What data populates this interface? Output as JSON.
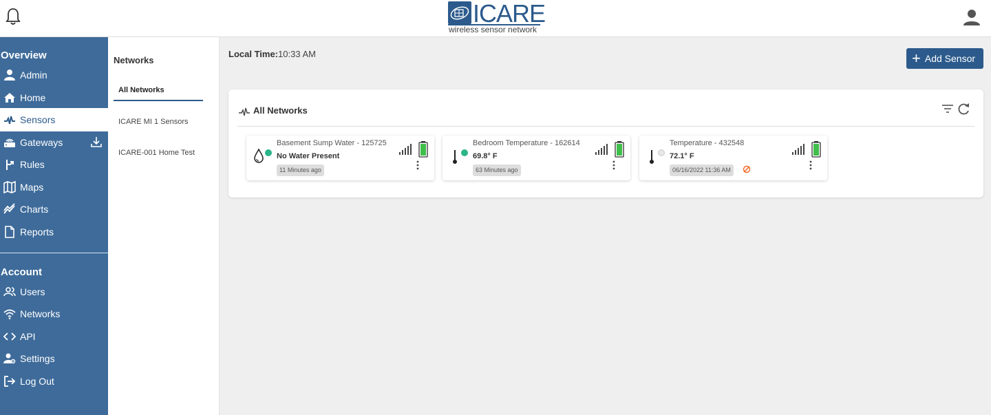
{
  "header": {
    "logo_text": "ICARE",
    "logo_subtitle": "wireless sensor network",
    "bell_icon": "bell-icon",
    "user_icon": "user-icon"
  },
  "sidebar": {
    "overview_title": "Overview",
    "account_title": "Account",
    "overview_items": [
      {
        "label": "Admin",
        "icon": "admin-icon"
      },
      {
        "label": "Home",
        "icon": "home-icon"
      },
      {
        "label": "Sensors",
        "icon": "pulse-icon",
        "active": true
      },
      {
        "label": "Gateways",
        "icon": "gateway-icon"
      },
      {
        "label": "Rules",
        "icon": "rules-icon"
      },
      {
        "label": "Maps",
        "icon": "map-icon"
      },
      {
        "label": "Charts",
        "icon": "chart-icon"
      },
      {
        "label": "Reports",
        "icon": "document-icon"
      }
    ],
    "account_items": [
      {
        "label": "Users",
        "icon": "users-icon"
      },
      {
        "label": "Networks",
        "icon": "wifi-icon"
      },
      {
        "label": "API",
        "icon": "code-icon"
      },
      {
        "label": "Settings",
        "icon": "user-settings-icon"
      },
      {
        "label": "Log Out",
        "icon": "logout-icon"
      }
    ]
  },
  "networks_panel": {
    "title": "Networks",
    "items": [
      "All Networks",
      "ICARE MI 1 Sensors",
      "ICARE-001 Home Test"
    ],
    "selected": "All Networks"
  },
  "main": {
    "local_time_label": "Local Time:",
    "local_time_value": "10:33 AM",
    "add_sensor_label": "Add Sensor",
    "card_title": "All Networks"
  },
  "sensors": [
    {
      "name": "Basement Sump Water - 125725",
      "value": "No Water Present",
      "time": "11 Minutes ago",
      "type": "water-drop-icon",
      "status_color": "#2bb58a",
      "battery_level": 1.0
    },
    {
      "name": "Bedroom Temperature - 162614",
      "value": "69.8° F",
      "time": "63 Minutes ago",
      "type": "thermometer-icon",
      "status_color": "#2bb58a",
      "battery_level": 1.0
    },
    {
      "name": "Temperature - 432548",
      "value": "72.1° F",
      "time": "06/16/2022 11:36 AM",
      "type": "thermometer-icon",
      "status_color": "#e6e6e6",
      "battery_level": 1.0,
      "warning": true
    }
  ],
  "colors": {
    "primary": "#3e6b9a",
    "button": "#2c5a8c",
    "ok_green": "#2bb58a",
    "battery_green": "#3fbf4a",
    "warning_orange": "#f26522"
  }
}
